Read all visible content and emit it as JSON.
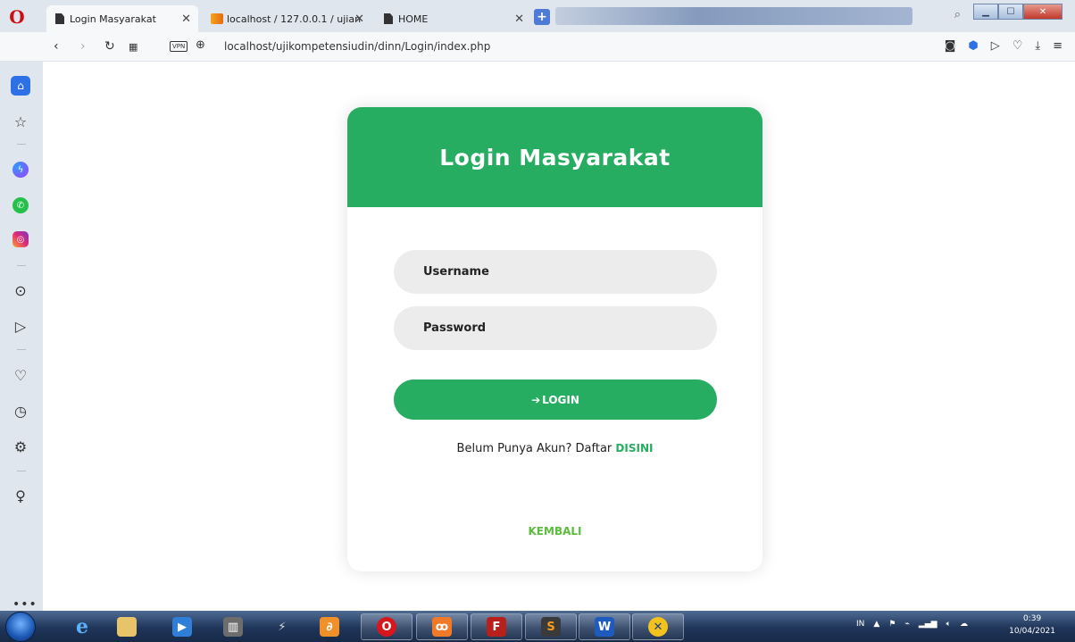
{
  "browser": {
    "tabs": [
      {
        "label": "Login Masyarakat",
        "active": true
      },
      {
        "label": "localhost / 127.0.0.1 / ujian",
        "active": false
      },
      {
        "label": "HOME",
        "active": false
      }
    ],
    "address_url": "localhost/ujikompetensiudin/dinn/Login/index.php",
    "vpn_label": "VPN"
  },
  "sidebar": {
    "icons": [
      "home-icon",
      "star-icon",
      "messenger-icon",
      "whatsapp-icon",
      "instagram-icon",
      "player-icon",
      "send-icon",
      "heart-icon",
      "history-icon",
      "settings-icon",
      "lightbulb-icon",
      "more-icon"
    ]
  },
  "login": {
    "title": "Login Masyarakat",
    "username_placeholder": "Username",
    "password_placeholder": "Password",
    "login_button": "LOGIN",
    "register_prompt": "Belum Punya Akun? Daftar",
    "register_link": "DISINI",
    "back_link": "KEMBALI"
  },
  "colors": {
    "accent_green": "#27ad61",
    "link_green": "#5dbb3f",
    "field_bg": "#ececec"
  },
  "taskbar": {
    "tray_lang": "IN",
    "time": "0:39",
    "date": "10/04/2021"
  }
}
